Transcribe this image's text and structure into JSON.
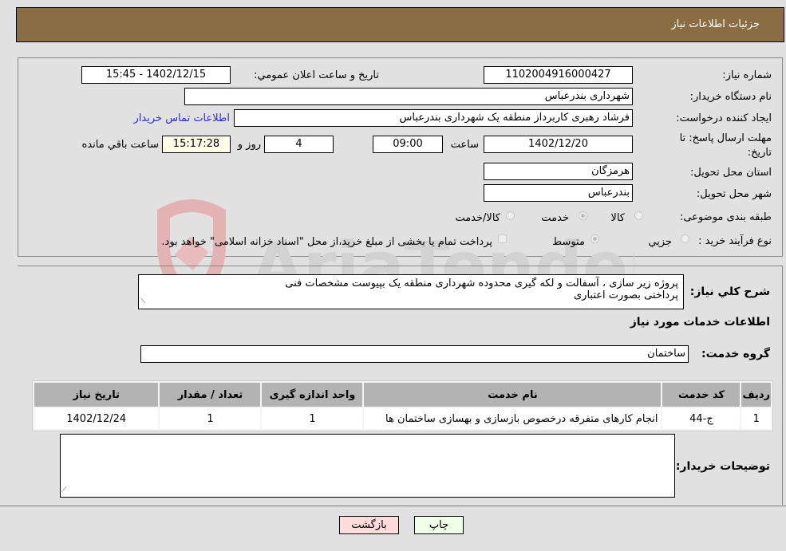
{
  "header": {
    "title": "جزئیات اطلاعات نیاز"
  },
  "form": {
    "need_number": {
      "label": "شماره نیاز:",
      "value": "1102004916000427"
    },
    "announce_datetime": {
      "label": "تاریخ و ساعت اعلان عمومي:",
      "value": "1402/12/15 - 15:45"
    },
    "buyer_org": {
      "label": "نام دستگاه خریدار:",
      "value": "شهرداری بندرعباس"
    },
    "requester": {
      "label": "ایجاد کننده درخواست:",
      "value": "فرشاد رهبری کاربرداز منطقه یک شهرداری بندرعباس"
    },
    "buyer_contact_link": "اطلاعات تماس خریدار",
    "deadline": {
      "label": "مهلت ارسال پاسخ: تا تاریخ:",
      "date": "1402/12/20",
      "time_label": "ساعت",
      "time": "09:00",
      "days": "4",
      "days_label": "روز و",
      "remaining": "15:17:28",
      "remaining_label": "ساعت باقي مانده"
    },
    "province": {
      "label": "استان محل تحویل:",
      "value": "هرمزگان"
    },
    "city": {
      "label": "شهر محل تحویل:",
      "value": "بندرعباس"
    },
    "category": {
      "label": "طبقه بندی موضوعی:",
      "options": [
        "کالا",
        "خدمت",
        "کالا/خدمت"
      ],
      "selected": "خدمت"
    },
    "purchase_type": {
      "label": "نوع فرآیند خرید :",
      "options": [
        "جزيي",
        "متوسط"
      ],
      "selected": "متوسط",
      "treasury_note": "پرداخت تمام یا بخشی از مبلغ خرید،از محل \"اسناد خزانه اسلامی\" خواهد بود."
    }
  },
  "description": {
    "label": "شرح کلي نیاز:",
    "value_line1": "پروژه زیر سازی ، آسفالت و لکه گیری محدوده شهرداری منطقه یک بپیوست مشخصات فنی",
    "value_line2": "پرداختی بصورت اعتباری"
  },
  "services_section": {
    "title": "اطلاعات خدمات مورد نیاز",
    "group_label": "گروه خدمت:",
    "group_value": "ساختمان"
  },
  "table": {
    "headers": [
      "ردیف",
      "کد خدمت",
      "نام خدمت",
      "واحد اندازه گیری",
      "تعداد / مقدار",
      "تاریخ نیاز"
    ],
    "rows": [
      [
        "1",
        "ج-44",
        "انجام کارهای متفرقه درخصوص بازسازی و بهسازی ساختمان ها",
        "1",
        "1",
        "1402/12/24"
      ]
    ]
  },
  "buyer_notes": {
    "label": "توضیحات خریدار:",
    "value": ""
  },
  "buttons": {
    "print": "چاپ",
    "back": "بازگشت"
  },
  "watermark": {
    "text": "AriaTender.neT"
  }
}
